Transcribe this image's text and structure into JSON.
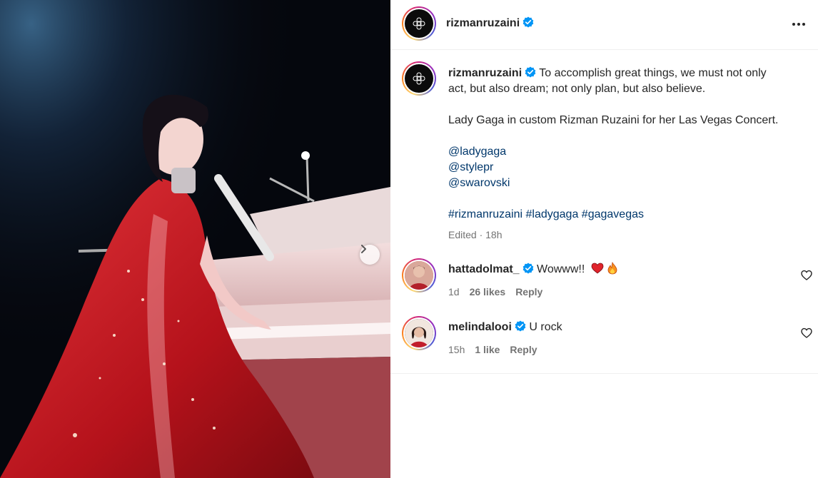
{
  "post": {
    "author": "rizmanruzaini",
    "author_avatar_icon": "rizman-ruzaini-logo-icon",
    "verified_icon": "verified-badge-icon",
    "more_icon": "more-options-icon",
    "next_icon": "chevron-right-icon"
  },
  "caption": {
    "username": "rizmanruzaini",
    "line1": "To accomplish great things, we must not only",
    "line2": "act, but also dream; not only plan, but also believe.",
    "line3": "Lady Gaga in custom Rizman Ruzaini for her Las Vegas Concert.",
    "mentions": [
      "@ladygaga",
      "@stylepr",
      "@swarovski"
    ],
    "hashtags": [
      "#rizmanruzaini",
      "#ladygaga",
      "#gagavegas"
    ],
    "meta": "Edited · 18h"
  },
  "comments": [
    {
      "username": "hattadolmat_",
      "text": "Wowww!!",
      "emojis": [
        "red-heart-icon",
        "fire-icon"
      ],
      "time": "1d",
      "likes": "26 likes",
      "reply": "Reply"
    },
    {
      "username": "melindalooi",
      "text": "U rock",
      "emojis": [],
      "time": "15h",
      "likes": "1 like",
      "reply": "Reply"
    }
  ],
  "colors": {
    "link": "#00376b",
    "muted": "#737373",
    "verified": "#0095f6",
    "like_heart": "#ed4956"
  }
}
